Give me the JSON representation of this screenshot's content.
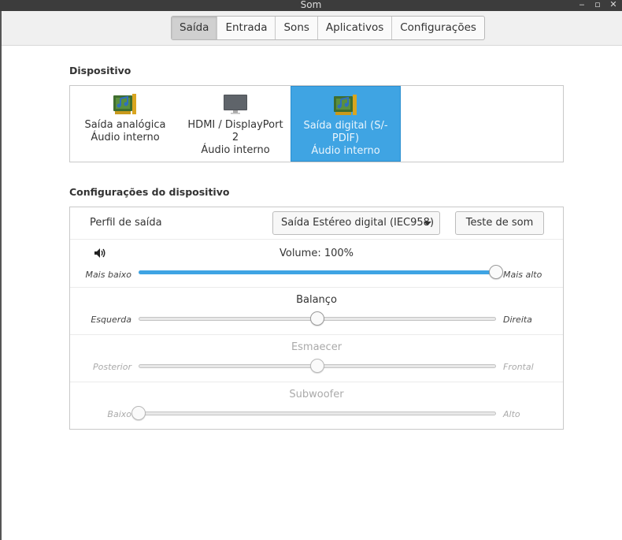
{
  "window": {
    "title": "Som"
  },
  "tabs": [
    {
      "label": "Saída",
      "active": true
    },
    {
      "label": "Entrada",
      "active": false
    },
    {
      "label": "Sons",
      "active": false
    },
    {
      "label": "Aplicativos",
      "active": false
    },
    {
      "label": "Configurações",
      "active": false
    }
  ],
  "devices_section": {
    "title": "Dispositivo",
    "items": [
      {
        "name": "Saída analógica",
        "subtitle": "Áudio interno",
        "icon": "sound-card-icon",
        "selected": false
      },
      {
        "name": "HDMI / DisplayPort 2",
        "subtitle": "Áudio interno",
        "icon": "monitor-icon",
        "selected": false
      },
      {
        "name": "Saída digital (S/-PDIF)",
        "subtitle": "Áudio interno",
        "icon": "sound-card-icon",
        "selected": true
      }
    ]
  },
  "device_settings": {
    "title": "Configurações do dispositivo",
    "output_profile": {
      "label": "Perfil de saída",
      "selected": "Saída Estéreo digital (IEC958)",
      "test_button": "Teste de som"
    },
    "volume": {
      "label": "Volume: 100%",
      "min_label": "Mais baixo",
      "max_label": "Mais alto",
      "value_percent": 100
    },
    "balance": {
      "label": "Balanço",
      "min_label": "Esquerda",
      "max_label": "Direita",
      "value_fraction": 0.5
    },
    "fade": {
      "label": "Esmaecer",
      "min_label": "Posterior",
      "max_label": "Frontal",
      "value_fraction": 0.5,
      "enabled": false
    },
    "subwoofer": {
      "label": "Subwoofer",
      "min_label": "Baixo",
      "max_label": "Alto",
      "value_fraction": 0.0,
      "enabled": false
    }
  },
  "colors": {
    "accent": "#3fa4e3",
    "titlebar": "#3c3c3c"
  }
}
